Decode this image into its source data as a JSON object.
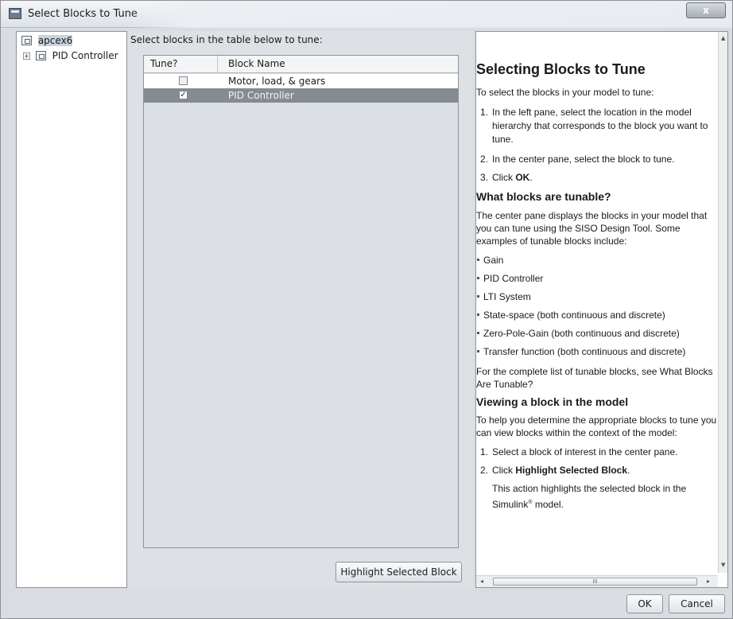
{
  "window": {
    "title": "Select Blocks to Tune",
    "close_glyph": "x"
  },
  "tree": {
    "root_label": "apcex6",
    "child_label": "PID Controller",
    "expander_glyph": "+",
    "icon": "model-block-icon"
  },
  "center": {
    "instructions": "Select blocks in the table below to tune:",
    "columns": [
      "Tune?",
      "Block Name"
    ],
    "rows": [
      {
        "tune": false,
        "name": "Motor, load, & gears"
      },
      {
        "tune": true,
        "name": "PID Controller"
      }
    ],
    "check_glyph": "✓",
    "highlight_button": "Highlight Selected Block"
  },
  "help": {
    "title": "Selecting Blocks to Tune",
    "intro": "To select the blocks in your model to tune:",
    "steps": [
      "In the left pane, select the location in the model hierarchy that corresponds to the block you want to tune.",
      "In the center pane, select the block to tune."
    ],
    "step3_prefix": "Click ",
    "step3_bold": "OK",
    "step3_suffix": ".",
    "section2_title": "What blocks are tunable?",
    "section2_text": "The center pane displays the blocks in your model that you can tune using the SISO Design Tool. Some examples of tunable blocks include:",
    "tunable_blocks": [
      "Gain",
      "PID Controller",
      "LTI System",
      "State-space (both continuous and discrete)",
      "Zero-Pole-Gain (both continuous and discrete)",
      "Transfer function (both continuous and discrete)"
    ],
    "section2_footer": "For the complete list of tunable blocks, see What Blocks Are Tunable?",
    "section3_title": "Viewing a block in the model",
    "section3_text": "To help you determine the appropriate blocks to tune you can view blocks within the context of the model:",
    "view_step1": "Select a block of interest in the center pane.",
    "view_step2_prefix": "Click ",
    "view_step2_bold": "Highlight Selected Block",
    "view_step2_suffix": ".",
    "view_note_prefix": "This action highlights the selected block in the Simulink",
    "view_note_sup": "®",
    "view_note_suffix": " model.",
    "numbers": [
      "1.",
      "2.",
      "3."
    ]
  },
  "scroll": {
    "up_glyph": "▲",
    "down_glyph": "▼",
    "left_glyph": "◂",
    "right_glyph": "▸",
    "grip": "III"
  },
  "footer": {
    "ok_label": "OK",
    "cancel_label": "Cancel"
  }
}
